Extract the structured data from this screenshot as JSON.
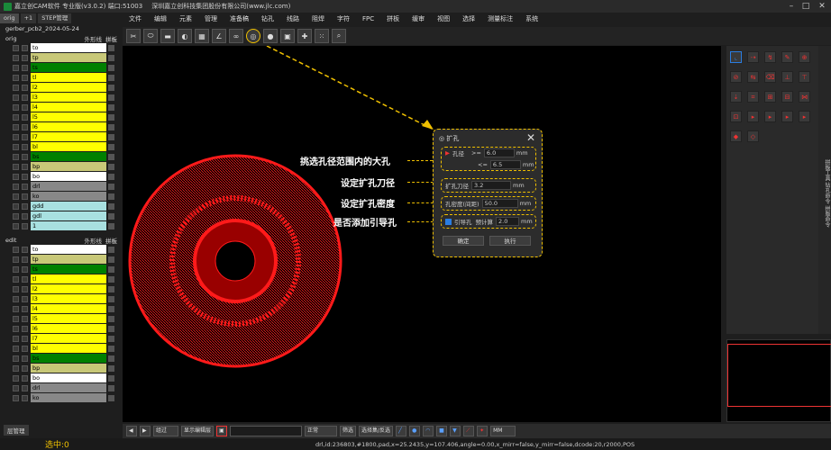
{
  "titlebar": {
    "title": "嘉立创CAM软件 专业版(v3.0.2) 端口:51003",
    "company": "深圳嘉立创科技集团股份有限公司(www.jlc.com)"
  },
  "menu": [
    "文件",
    "编辑",
    "元素",
    "管理",
    "准备稿",
    "钻孔",
    "线路",
    "阻焊",
    "字符",
    "FPC",
    "拼板",
    "缓审",
    "视图",
    "选择",
    "测量标注",
    "系统"
  ],
  "tabs": [
    "orig",
    "+1",
    "STEP管理"
  ],
  "job": "gerber_pcb2_2024-05-24",
  "group1": {
    "name": "orig",
    "opt1": "外形线",
    "opt2": "拼板"
  },
  "group2": {
    "name": "edit",
    "opt1": "外形线",
    "opt2": "拼板"
  },
  "layers1": [
    {
      "n": "to",
      "c": "#ffffff"
    },
    {
      "n": "tp",
      "c": "#c8c878"
    },
    {
      "n": "ts",
      "c": "#008000"
    },
    {
      "n": "tl",
      "c": "#ffff00"
    },
    {
      "n": "l2",
      "c": "#ffff00"
    },
    {
      "n": "l3",
      "c": "#ffff00"
    },
    {
      "n": "l4",
      "c": "#ffff00"
    },
    {
      "n": "l5",
      "c": "#ffff00"
    },
    {
      "n": "l6",
      "c": "#ffff00"
    },
    {
      "n": "l7",
      "c": "#ffff00"
    },
    {
      "n": "bl",
      "c": "#ffff00"
    },
    {
      "n": "bs",
      "c": "#008000"
    },
    {
      "n": "bp",
      "c": "#c8c878"
    },
    {
      "n": "bo",
      "c": "#ffffff"
    },
    {
      "n": "drl",
      "c": "#888888"
    },
    {
      "n": "ko",
      "c": "#888888"
    },
    {
      "n": "gdd",
      "c": "#a8e0e0"
    },
    {
      "n": "gdl",
      "c": "#a8e0e0"
    },
    {
      "n": "1",
      "c": "#a8e0e0"
    }
  ],
  "layers2": [
    {
      "n": "to",
      "c": "#ffffff"
    },
    {
      "n": "tp",
      "c": "#c8c878"
    },
    {
      "n": "ts",
      "c": "#008000"
    },
    {
      "n": "tl",
      "c": "#ffff00"
    },
    {
      "n": "l2",
      "c": "#ffff00"
    },
    {
      "n": "l3",
      "c": "#ffff00"
    },
    {
      "n": "l4",
      "c": "#ffff00"
    },
    {
      "n": "l5",
      "c": "#ffff00"
    },
    {
      "n": "l6",
      "c": "#ffff00"
    },
    {
      "n": "l7",
      "c": "#ffff00"
    },
    {
      "n": "bl",
      "c": "#ffff00"
    },
    {
      "n": "bs",
      "c": "#008000"
    },
    {
      "n": "bp",
      "c": "#c8c878"
    },
    {
      "n": "bo",
      "c": "#ffffff"
    },
    {
      "n": "drl",
      "c": "#888888"
    },
    {
      "n": "ko",
      "c": "#888888"
    }
  ],
  "dialog": {
    "title": "扩孔",
    "hole_label": "孔径",
    "min_op": ">=",
    "min_val": "6.0",
    "max_op": "<=",
    "max_val": "6.5",
    "unit": "mm",
    "tool_label": "扩孔刀径",
    "tool_val": "3.2",
    "density_label": "孔密度(间距)",
    "density_val": "50.0",
    "guide_label": "引导孔",
    "guide_offset_label": "预计算",
    "guide_val": "2.0",
    "ok": "确定",
    "exec": "执行"
  },
  "annotations": [
    "挑选孔径范围内的大孔",
    "设定扩孔刀径",
    "设定扩孔密度",
    "是否添加引导孔"
  ],
  "bottom": {
    "mode": "组过",
    "show": "显示编辑层",
    "filter": "正常",
    "select": "筛选",
    "panel": "选择集/反选",
    "unit": "MM",
    "layer_mgr": "层管理"
  },
  "selected": "选中:0",
  "status": "drl,id:236803,#1800,pad,x=25.2435,y=107.406,angle=0.00,x_mirr=false,y_mirr=false,dcode:20,r2000,POS",
  "right_side": "拼板工具 钻孔命令 拼版命令",
  "colors": {
    "accent": "#f0c000",
    "ring": "#ff1a1a"
  }
}
